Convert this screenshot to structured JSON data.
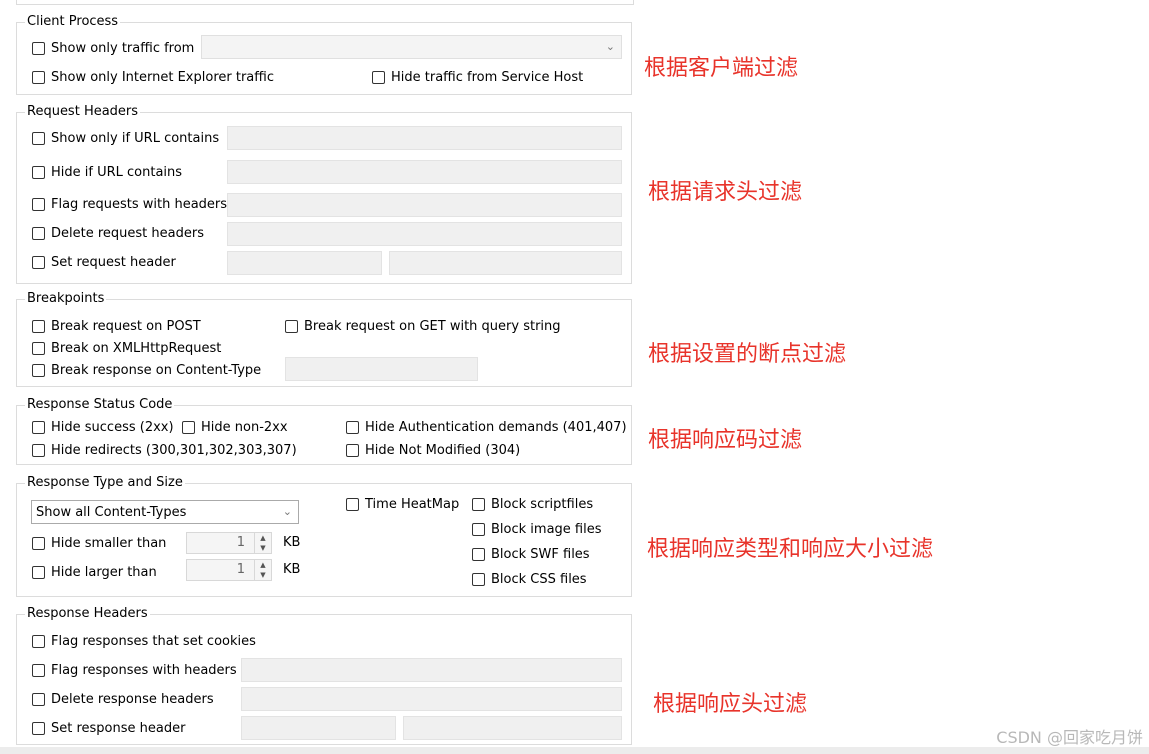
{
  "client_process": {
    "legend": "Client Process",
    "show_only_traffic_from": "Show only traffic from",
    "show_only_ie": "Show only Internet Explorer traffic",
    "hide_service_host": "Hide traffic from Service Host"
  },
  "request_headers": {
    "legend": "Request Headers",
    "show_only_url": "Show only if URL contains",
    "hide_url": "Hide if URL contains",
    "flag_requests": "Flag requests with headers",
    "delete_request_headers": "Delete request headers",
    "set_request_header": "Set request header"
  },
  "breakpoints": {
    "legend": "Breakpoints",
    "break_post": "Break request on POST",
    "break_get": "Break request on GET with query string",
    "break_xhr": "Break on XMLHttpRequest",
    "break_content_type": "Break response on Content-Type"
  },
  "status_code": {
    "legend": "Response Status Code",
    "hide_success": "Hide success (2xx)",
    "hide_non2xx": "Hide non-2xx",
    "hide_auth": "Hide Authentication demands (401,407)",
    "hide_redirects": "Hide redirects (300,301,302,303,307)",
    "hide_not_modified": "Hide Not Modified (304)"
  },
  "type_size": {
    "legend": "Response Type and Size",
    "content_types_selected": "Show all Content-Types",
    "time_heatmap": "Time HeatMap",
    "block_script": "Block scriptfiles",
    "block_image": "Block image files",
    "block_swf": "Block SWF files",
    "block_css": "Block CSS files",
    "hide_smaller": "Hide smaller than",
    "hide_larger": "Hide larger than",
    "smaller_value": "1",
    "larger_value": "1",
    "unit": "KB"
  },
  "response_headers": {
    "legend": "Response Headers",
    "flag_cookies": "Flag responses that set cookies",
    "flag_responses": "Flag responses with headers",
    "delete_response_headers": "Delete response headers",
    "set_response_header": "Set response header"
  },
  "annotations": {
    "client": "根据客户端过滤",
    "request_headers": "根据请求头过滤",
    "breakpoints": "根据设置的断点过滤",
    "status_code": "根据响应码过滤",
    "type_size": "根据响应类型和响应大小过滤",
    "response_headers": "根据响应头过滤",
    "color": "#e8332a"
  },
  "watermark": "CSDN @回家吃月饼"
}
